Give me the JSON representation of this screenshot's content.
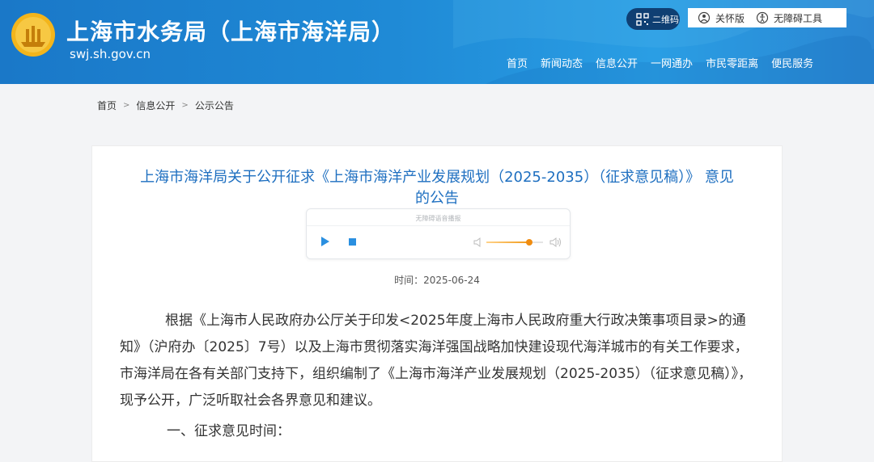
{
  "header": {
    "title": "上海市水务局（上海市海洋局）",
    "url": "swj.sh.gov.cn",
    "qr_label": "二维码",
    "care_label": "关怀版",
    "accessibility_label": "无障碍工具",
    "nav": [
      "首页",
      "新闻动态",
      "信息公开",
      "一网通办",
      "市民零距离",
      "便民服务"
    ]
  },
  "breadcrumb": {
    "items": [
      "首页",
      "信息公开",
      "公示公告"
    ],
    "separator": ">"
  },
  "article": {
    "title_line1": "上海市海洋局关于公开征求《上海市海洋产业发展规划（2025-2035）（征求意见稿）》 意见",
    "title_line2": "的公告",
    "player_caption": "无障碍语音播报",
    "volume_level": 0.75,
    "date": "时间：2025-06-24",
    "paragraph": "根据《上海市人民政府办公厅关于印发<2025年度上海市人民政府重大行政决策事项目录>的通知》（沪府办〔2025〕7号）以及上海市贯彻落实海洋强国战略加快建设现代海洋城市的有关工作要求，市海洋局在各有关部门支持下，组织编制了《上海市海洋产业发展规划（2025-2035）（征求意见稿）》，现予公开，广泛听取社会各界意见和建议。",
    "section1": "一、征求意见时间："
  },
  "colors": {
    "header_blue": "#1f8ad6",
    "title_blue": "#1e6fc0",
    "player_blue": "#2a8fe0",
    "volume_orange": "#f08c10"
  }
}
